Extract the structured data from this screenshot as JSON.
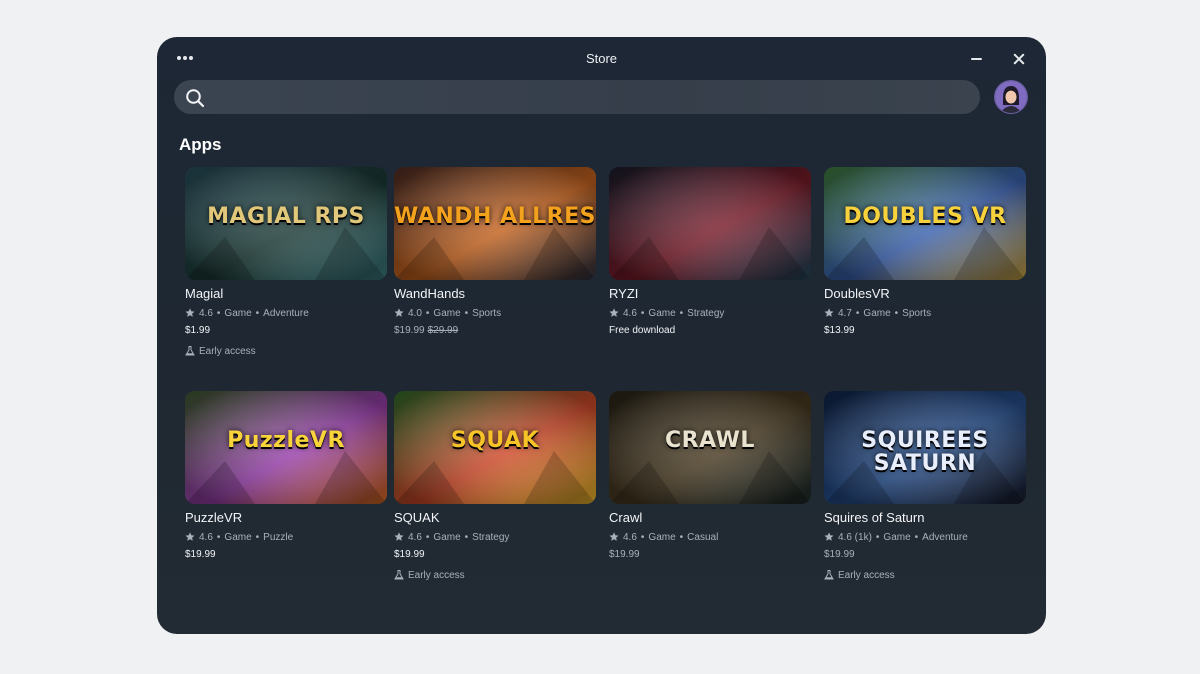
{
  "window": {
    "title": "Store"
  },
  "search": {
    "placeholder": ""
  },
  "section": {
    "title": "Apps"
  },
  "apps": [
    {
      "name": "Magial",
      "rating": "4.6",
      "category": "Game",
      "genre": "Adventure",
      "price": "$1.99",
      "original_price": "",
      "early_access": "Early access",
      "logo_text": "MAGIAL RPS",
      "colors": [
        "#2a4f5c",
        "#1b3a36",
        "#3d7c82"
      ],
      "logo_color": "#e0c77a"
    },
    {
      "name": "WandHands",
      "rating": "4.0",
      "category": "Game",
      "genre": "Sports",
      "price": "$19.99",
      "original_price": "$29.99",
      "early_access": "",
      "logo_text": "WANDH ALLRES",
      "colors": [
        "#4b2c24",
        "#c8641e",
        "#2d3140"
      ],
      "logo_color": "#f4a11d"
    },
    {
      "name": "RYZI",
      "rating": "4.6",
      "category": "Game",
      "genre": "Strategy",
      "price": "Free download",
      "original_price": "",
      "early_access": "",
      "logo_text": "",
      "colors": [
        "#1a1d2c",
        "#7a1c2a",
        "#23465c"
      ],
      "logo_color": "#e8455a"
    },
    {
      "name": "DoublesVR",
      "rating": "4.7",
      "category": "Game",
      "genre": "Sports",
      "price": "$13.99",
      "original_price": "",
      "early_access": "",
      "logo_text": "DOUBLES VR",
      "colors": [
        "#3f7a3b",
        "#3b63b3",
        "#c9a241"
      ],
      "logo_color": "#f7d23c"
    },
    {
      "name": "PuzzleVR",
      "rating": "4.6",
      "category": "Game",
      "genre": "Puzzle",
      "price": "$19.99",
      "original_price": "",
      "early_access": "",
      "logo_text": "PuzzleVR",
      "colors": [
        "#3c5a2e",
        "#9a3fae",
        "#d96a1e"
      ],
      "logo_color": "#f8d33a"
    },
    {
      "name": "SQUAK",
      "rating": "4.6",
      "category": "Game",
      "genre": "Strategy",
      "price": "$19.99",
      "original_price": "",
      "early_access": "Early access",
      "logo_text": "SQUAK",
      "colors": [
        "#2f6b2a",
        "#d2492a",
        "#e9b92c"
      ],
      "logo_color": "#f6c429"
    },
    {
      "name": "Crawl",
      "rating": "4.6",
      "category": "Game",
      "genre": "Casual",
      "price": "$19.99",
      "original_price": "",
      "early_access": "",
      "logo_text": "CRAWL",
      "colors": [
        "#2a2418",
        "#4a3b22",
        "#1c2b2b"
      ],
      "logo_color": "#e9e2cf"
    },
    {
      "name": "Squires of Saturn",
      "rating": "4.6 (1k)",
      "category": "Game",
      "genre": "Adventure",
      "price": "$19.99",
      "original_price": "",
      "early_access": "Early access",
      "logo_text": "SQUIREES SATURN",
      "colors": [
        "#102447",
        "#27508f",
        "#1a1d2c"
      ],
      "logo_color": "#e8eefb"
    }
  ]
}
